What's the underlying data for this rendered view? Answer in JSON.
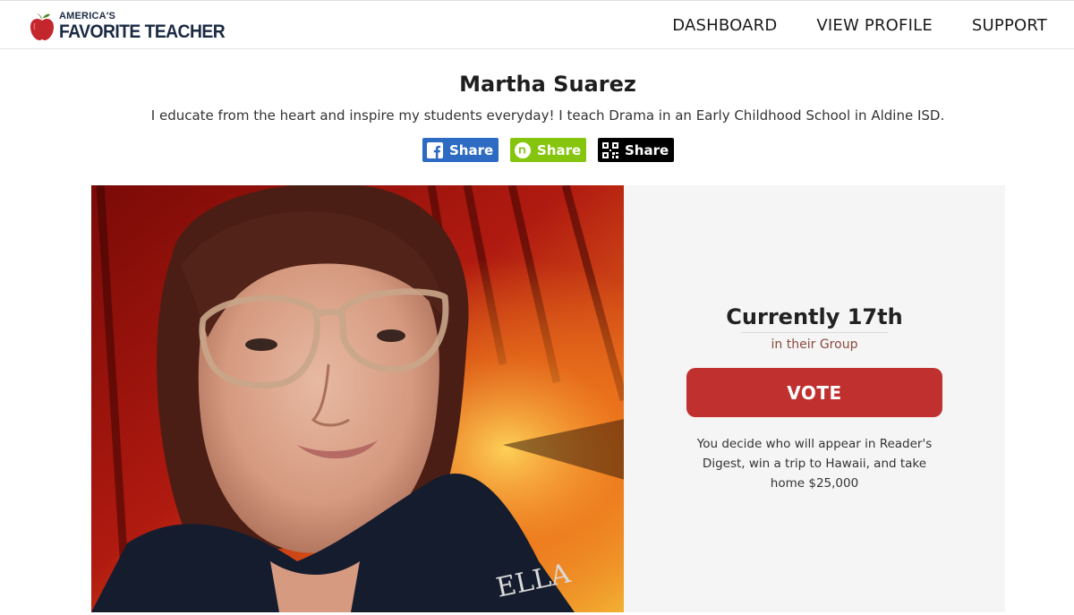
{
  "brand": {
    "line1": "AMERICA'S",
    "line2": "FAVORITE TEACHER",
    "apple_color": "#c4262e",
    "navy": "#1b2a44"
  },
  "nav": {
    "dashboard": "DASHBOARD",
    "view_profile": "VIEW PROFILE",
    "support": "SUPPORT"
  },
  "profile": {
    "name": "Martha Suarez",
    "bio": "I educate from the heart and inspire my students everyday! I teach Drama in an Early Childhood School in Aldine ISD.",
    "photo_icon": "teacher-portrait"
  },
  "share": {
    "facebook": {
      "label": "Share",
      "icon": "facebook-icon",
      "color": "#2d6bc2"
    },
    "nextdoor": {
      "label": "Share",
      "icon": "nextdoor-icon",
      "color": "#86c50e"
    },
    "qr": {
      "label": "Share",
      "icon": "qr-code-icon",
      "color": "#000000"
    }
  },
  "standing": {
    "rank": "Currently 17th",
    "group": "in their Group",
    "vote_label": "VOTE",
    "vote_color": "#c0302f",
    "description": "You decide who will appear in Reader's Digest, win a trip to Hawaii, and take home $25,000"
  }
}
